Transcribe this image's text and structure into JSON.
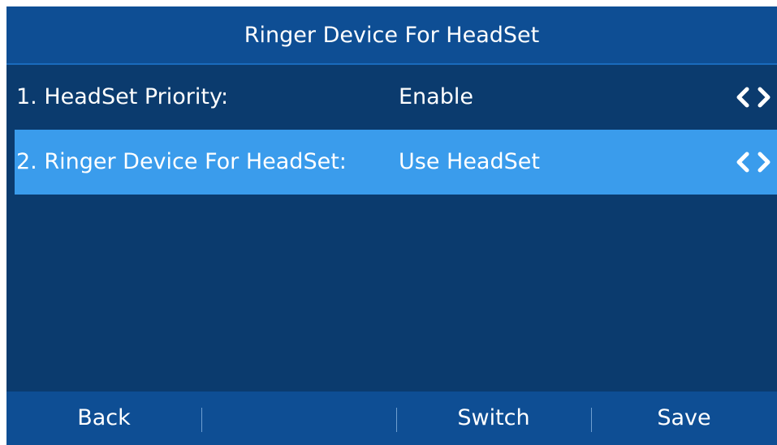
{
  "title": "Ringer Device For HeadSet",
  "items": [
    {
      "label": "1. HeadSet Priority:",
      "value": "Enable",
      "selected": false
    },
    {
      "label": "2. Ringer Device For HeadSet:",
      "value": "Use HeadSet",
      "selected": true
    }
  ],
  "softkeys": {
    "key1": "Back",
    "key2": "",
    "key3": "Switch",
    "key4": "Save"
  },
  "colors": {
    "background": "#0b3b6e",
    "title_bar": "#0e4e94",
    "selected_row": "#3a9cec",
    "text": "#ffffff"
  },
  "icons": {
    "prev": "chevron-left-icon",
    "next": "chevron-right-icon"
  }
}
